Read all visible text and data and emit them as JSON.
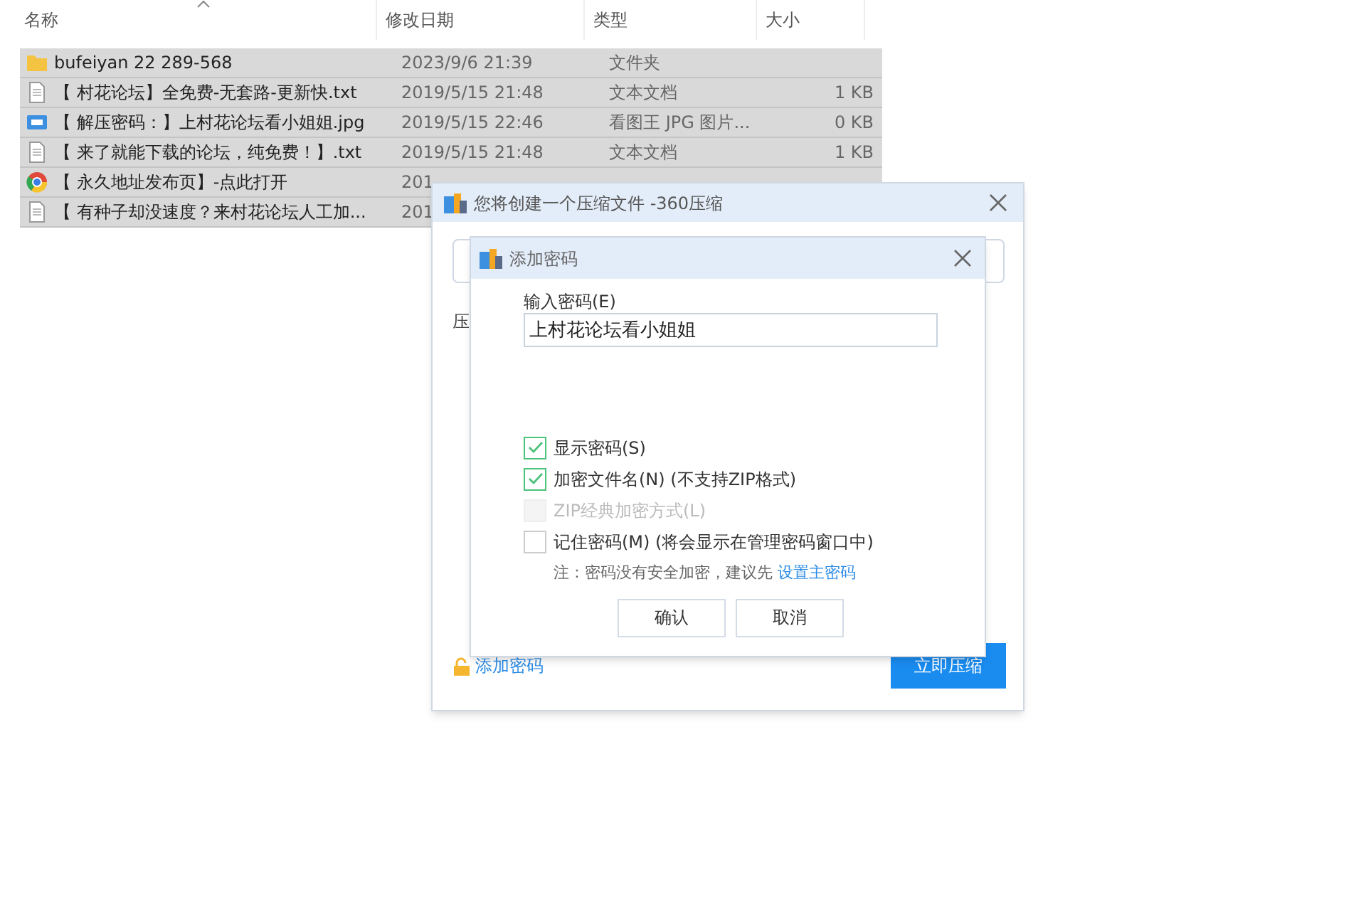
{
  "file_list": {
    "columns": [
      {
        "label": "名称",
        "sorted": true
      },
      {
        "label": "修改日期",
        "sorted": false
      },
      {
        "label": "类型",
        "sorted": false
      },
      {
        "label": "大小",
        "sorted": false
      }
    ],
    "rows": [
      {
        "kind": "folder",
        "name": "bufeiyan 22  289-568",
        "date": "2023/9/6 21:39",
        "type": "文件夹",
        "size": ""
      },
      {
        "kind": "text",
        "name": "【 村花论坛】全免费-无套路-更新快.txt",
        "date": "2019/5/15 21:48",
        "type": "文本文档",
        "size": "1 KB"
      },
      {
        "kind": "image",
        "name": "【 解压密码：】上村花论坛看小姐姐.jpg",
        "date": "2019/5/15 22:46",
        "type": "看图王 JPG 图片...",
        "size": "0 KB"
      },
      {
        "kind": "text",
        "name": "【 来了就能下载的论坛，纯免费！】.txt",
        "date": "2019/5/15 21:48",
        "type": "文本文档",
        "size": "1 KB"
      },
      {
        "kind": "link",
        "name": "【 永久地址发布页】-点此打开",
        "date": "201",
        "type": "",
        "size": ""
      },
      {
        "kind": "text",
        "name": "【 有种子却没速度？来村花论坛人工加...",
        "date": "201",
        "type": "",
        "size": ""
      }
    ]
  },
  "compress_dialog": {
    "title": "您将创建一个压缩文件 -360压缩",
    "label": "压",
    "add_password_link": "添加密码",
    "compress_button": "立即压缩"
  },
  "password_dialog": {
    "title": "添加密码",
    "input_label": "输入密码(E)",
    "password": "上村花论坛看小姐姐",
    "options": [
      {
        "label": "显示密码(S)",
        "checked": true,
        "disabled": false
      },
      {
        "label": "加密文件名(N) (不支持ZIP格式)",
        "checked": true,
        "disabled": false
      },
      {
        "label": "ZIP经典加密方式(L)",
        "checked": false,
        "disabled": true
      },
      {
        "label": "记住密码(M) (将会显示在管理密码窗口中)",
        "checked": false,
        "disabled": false
      }
    ],
    "note": "注：密码没有安全加密，建议先",
    "note_link": "设置主密码",
    "buttons": [
      "确认",
      "取消"
    ]
  }
}
